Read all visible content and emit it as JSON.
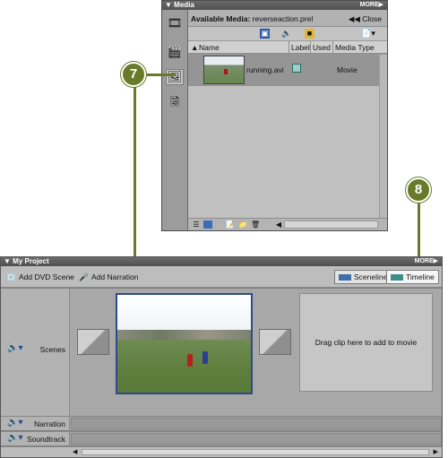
{
  "media_panel": {
    "title": "Media",
    "more": "MORE▶",
    "available_label": "Available Media:",
    "project_file": "reverseaction.prel",
    "close_label": "Close",
    "columns": {
      "name": "Name",
      "label": "Label",
      "used": "Used",
      "media_type": "Media Type"
    },
    "items": [
      {
        "name": "running.avi",
        "type": "Movie"
      }
    ]
  },
  "callouts": {
    "first": "7",
    "second": "8"
  },
  "project_panel": {
    "title": "My Project",
    "more": "MORE▶",
    "add_dvd_scene": "Add DVD Scene",
    "add_narration": "Add Narration",
    "sceneline": "Sceneline",
    "timeline": "Timeline",
    "drop_hint": "Drag clip here to add to movie",
    "tracks": {
      "scenes": "Scenes",
      "narration": "Narration",
      "soundtrack": "Soundtrack"
    }
  },
  "colors": {
    "callout": "#6b7a2a",
    "selection_border": "#2e4a8c",
    "accent_blue": "#1d4c92"
  }
}
